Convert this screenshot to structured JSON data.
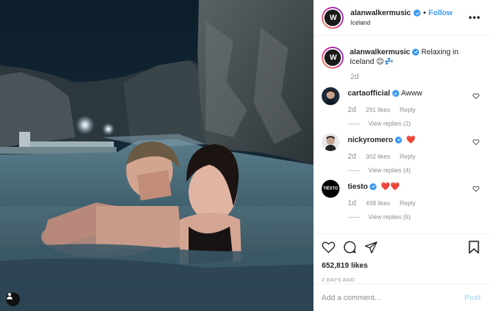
{
  "post": {
    "username": "alanwalkermusic",
    "follow_label": "Follow",
    "location": "Iceland",
    "more_label": "•••",
    "caption": "Relaxing in Iceland 😊💤",
    "caption_time": "2d",
    "likes": "652,819 likes",
    "date": "2 DAYS AGO"
  },
  "comments": [
    {
      "username": "cartaofficial",
      "text": "Awww",
      "hearts": "",
      "time": "2d",
      "likes": "291 likes",
      "reply_label": "Reply",
      "view_replies": "View replies (2)"
    },
    {
      "username": "nickyromero",
      "text": "",
      "hearts": "❤️",
      "time": "2d",
      "likes": "302 likes",
      "reply_label": "Reply",
      "view_replies": "View replies (4)"
    },
    {
      "username": "tiesto",
      "text": "",
      "hearts": "❤️❤️",
      "time": "1d",
      "likes": "498 likes",
      "reply_label": "Reply",
      "view_replies": "View replies (6)"
    }
  ],
  "comment_box": {
    "placeholder": "Add a comment...",
    "post_label": "Post"
  },
  "icons": [
    "tag-user-icon",
    "heart-icon",
    "comment-icon",
    "share-icon",
    "bookmark-icon",
    "more-options-icon",
    "verified-icon"
  ],
  "colors": {
    "link": "#3897f0",
    "verified": "#3897f0",
    "muted": "#8e8e8e",
    "heart": "#e0245e",
    "post_disabled": "#b2dffc"
  }
}
